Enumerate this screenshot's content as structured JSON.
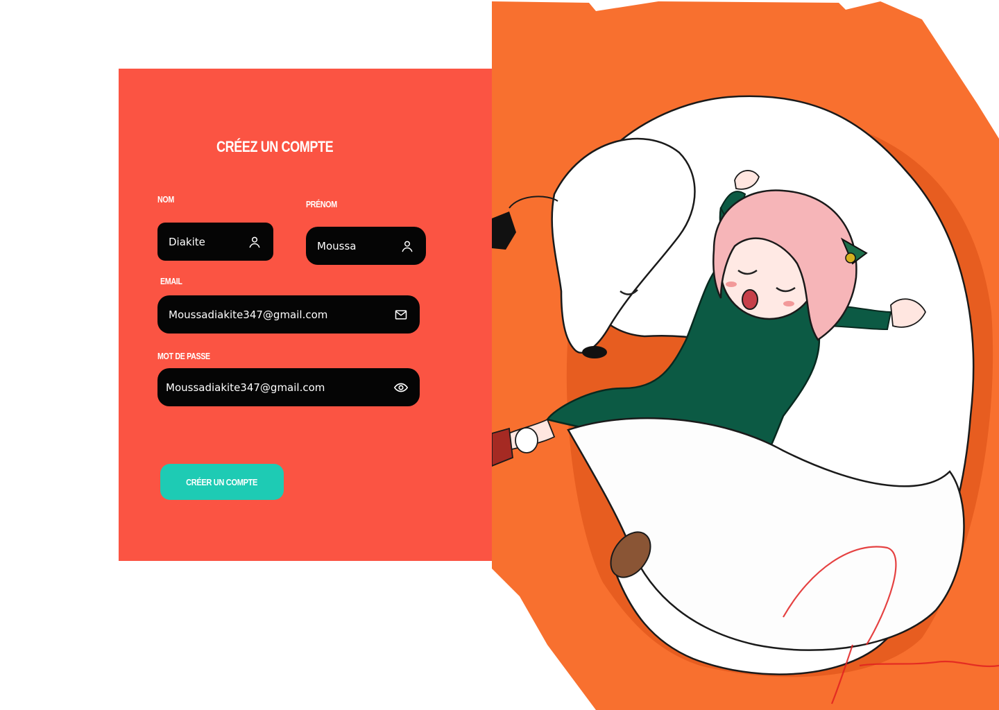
{
  "form": {
    "title": "Créez un compte",
    "nom": {
      "label": "Nom",
      "value": "Diakite",
      "icon": "user-icon"
    },
    "prenom": {
      "label": "Prénom",
      "value": "Moussa",
      "icon": "user-icon"
    },
    "email": {
      "label": "Email",
      "value": "Moussadiakite347@gmail.com",
      "icon": "envelope-icon"
    },
    "password": {
      "label": "Mot de passe",
      "value": "Moussadiakite347@gmail.com",
      "icon": "eye-icon"
    },
    "submit_label": "Créer un compte"
  },
  "illustration": {
    "description_icon": "sleeping-girl-with-white-dog-illustration"
  },
  "colors": {
    "card_background": "#fb5443",
    "input_background": "#050505",
    "button_background": "#1ecbb4",
    "illustration_background": "#f8702f",
    "text": "#ffffff"
  }
}
